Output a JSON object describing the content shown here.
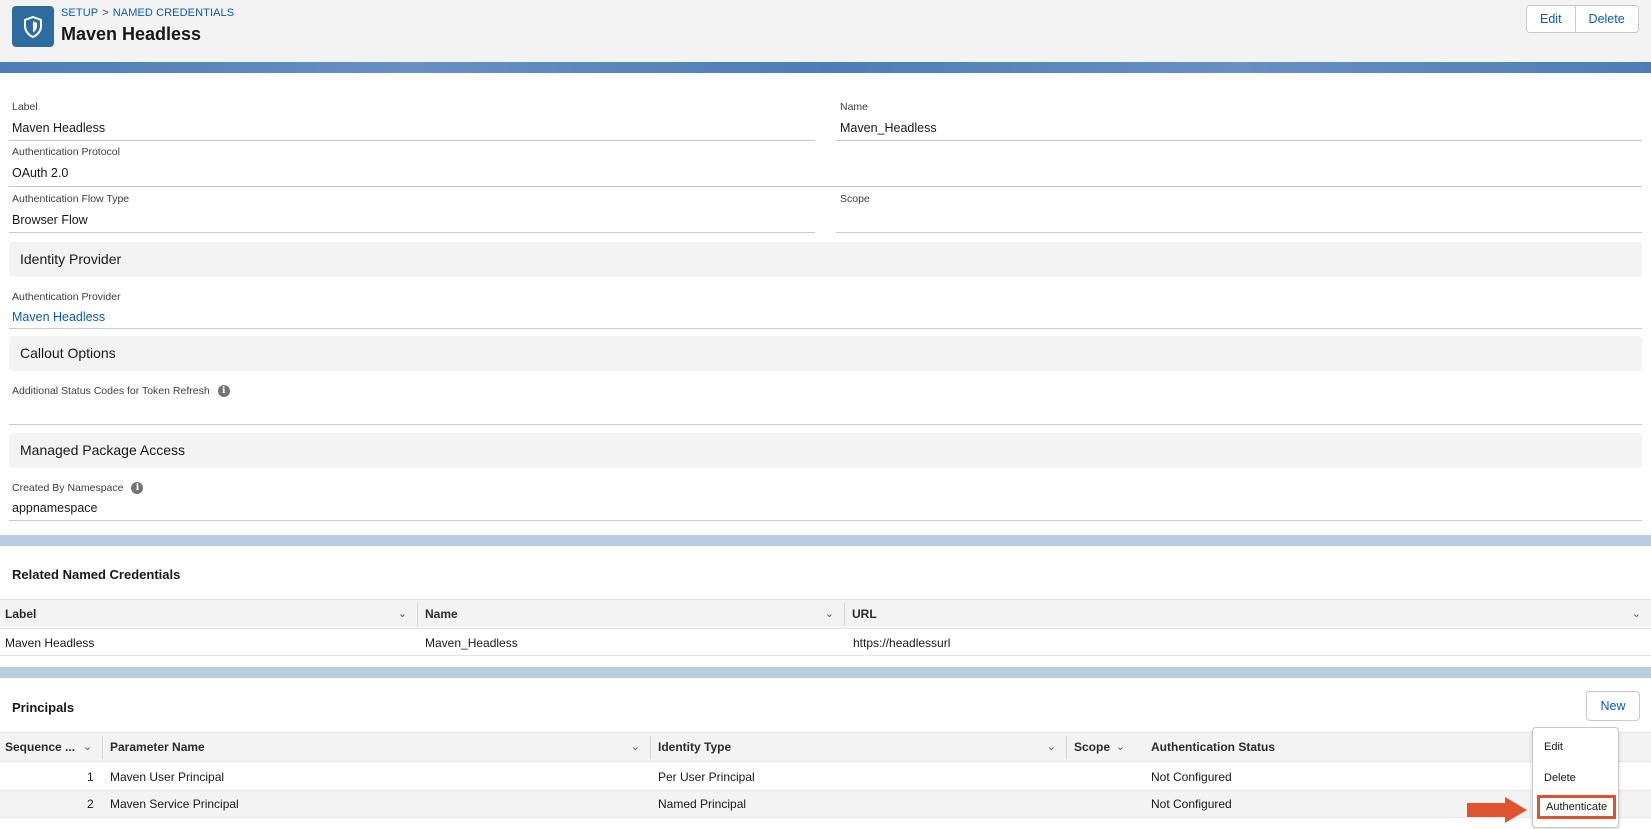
{
  "header": {
    "breadcrumb": [
      "SETUP",
      "NAMED CREDENTIALS"
    ],
    "title": "Maven Headless",
    "edit_label": "Edit",
    "delete_label": "Delete",
    "icon": "shield-icon"
  },
  "details": {
    "label_label": "Label",
    "label_value": "Maven Headless",
    "name_label": "Name",
    "name_value": "Maven_Headless",
    "auth_protocol_label": "Authentication Protocol",
    "auth_protocol_value": "OAuth 2.0",
    "flow_type_label": "Authentication Flow Type",
    "flow_type_value": "Browser Flow",
    "scope_label": "Scope",
    "scope_value": ""
  },
  "identity_provider": {
    "section_title": "Identity Provider",
    "provider_label": "Authentication Provider",
    "provider_value": "Maven Headless"
  },
  "callout_options": {
    "section_title": "Callout Options",
    "status_codes_label": "Additional Status Codes for Token Refresh",
    "status_codes_value": ""
  },
  "managed_package": {
    "section_title": "Managed Package Access",
    "namespace_label": "Created By Namespace",
    "namespace_value": "appnamespace"
  },
  "related": {
    "title": "Related Named Credentials",
    "columns": [
      "Label",
      "Name",
      "URL"
    ],
    "rows": [
      {
        "label": "Maven Headless",
        "name": "Maven_Headless",
        "url": "https://headlessurl"
      }
    ]
  },
  "principals": {
    "title": "Principals",
    "new_label": "New",
    "columns": [
      "Sequence ...",
      "Parameter Name",
      "Identity Type",
      "Scope",
      "Authentication Status"
    ],
    "rows": [
      {
        "seq": "1",
        "param": "Maven User Principal",
        "identity": "Per User Principal",
        "scope": "",
        "status": "Not Configured"
      },
      {
        "seq": "2",
        "param": "Maven Service Principal",
        "identity": "Named Principal",
        "scope": "",
        "status": "Not Configured"
      }
    ]
  },
  "row_menu": {
    "items": [
      "Edit",
      "Delete",
      "Authenticate"
    ]
  },
  "colors": {
    "accent": "#0b5cab",
    "header_icon_bg": "#2e6b9e",
    "highlight": "#e0532f"
  }
}
